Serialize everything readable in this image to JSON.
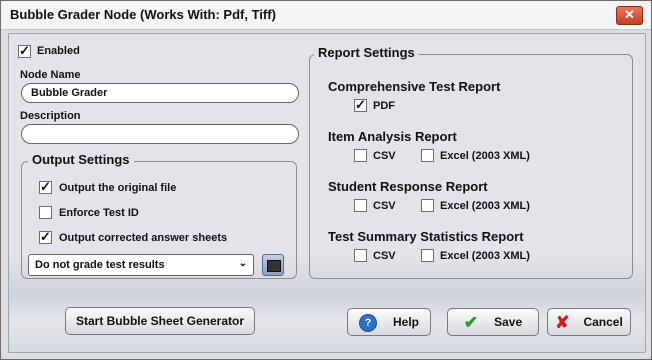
{
  "window": {
    "title": "Bubble Grader Node    (Works With: Pdf, Tiff)",
    "close_glyph": "✕"
  },
  "general": {
    "enabled_label": "Enabled",
    "enabled_checked": true,
    "node_name_label": "Node Name",
    "node_name_value": "Bubble Grader",
    "description_label": "Description",
    "description_value": ""
  },
  "output_settings": {
    "title": "Output Settings",
    "output_original_label": "Output the original file",
    "output_original_checked": true,
    "enforce_test_id_label": "Enforce Test ID",
    "enforce_test_id_checked": false,
    "output_corrected_label": "Output corrected answer sheets",
    "output_corrected_checked": true,
    "grade_select_value": "Do not grade test results"
  },
  "report_settings": {
    "title": "Report Settings",
    "comprehensive": {
      "heading": "Comprehensive Test Report",
      "pdf_label": "PDF",
      "pdf_checked": true
    },
    "item_analysis": {
      "heading": "Item Analysis Report",
      "csv_label": "CSV",
      "csv_checked": false,
      "excel_label": "Excel (2003 XML)",
      "excel_checked": false
    },
    "student_response": {
      "heading": "Student Response Report",
      "csv_label": "CSV",
      "csv_checked": false,
      "excel_label": "Excel (2003 XML)",
      "excel_checked": false
    },
    "test_summary": {
      "heading": "Test Summary Statistics Report",
      "csv_label": "CSV",
      "csv_checked": false,
      "excel_label": "Excel (2003 XML)",
      "excel_checked": false
    }
  },
  "footer": {
    "generator_label": "Start Bubble Sheet Generator",
    "help_label": "Help",
    "save_label": "Save",
    "cancel_label": "Cancel"
  }
}
